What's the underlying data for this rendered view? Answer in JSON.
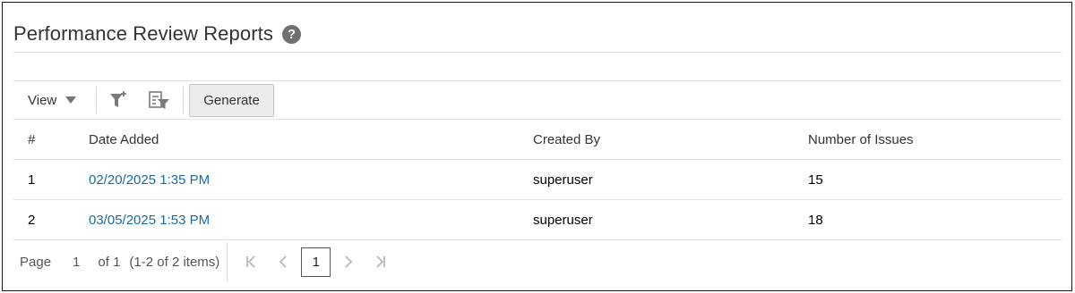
{
  "page": {
    "title": "Performance Review Reports",
    "help_icon": "?"
  },
  "toolbar": {
    "view_label": "View",
    "icons": [
      "filter-add-icon",
      "filter-row-icon"
    ],
    "generate_label": "Generate"
  },
  "table": {
    "headers": [
      "#",
      "Date Added",
      "Created By",
      "Number of Issues"
    ],
    "rows": [
      {
        "num": "1",
        "date_added": "02/20/2025 1:35 PM",
        "created_by": "superuser",
        "issues": "15"
      },
      {
        "num": "2",
        "date_added": "03/05/2025 1:53 PM",
        "created_by": "superuser",
        "issues": "18"
      }
    ]
  },
  "pagination": {
    "page_label": "Page",
    "page_value": "1",
    "of_label": "of 1",
    "range_label": "(1-2 of 2 items)",
    "current_page": "1"
  },
  "colors": {
    "link": "#1a6aa5",
    "help_icon_bg": "#6f6f6f",
    "button_bg": "#ececec"
  }
}
